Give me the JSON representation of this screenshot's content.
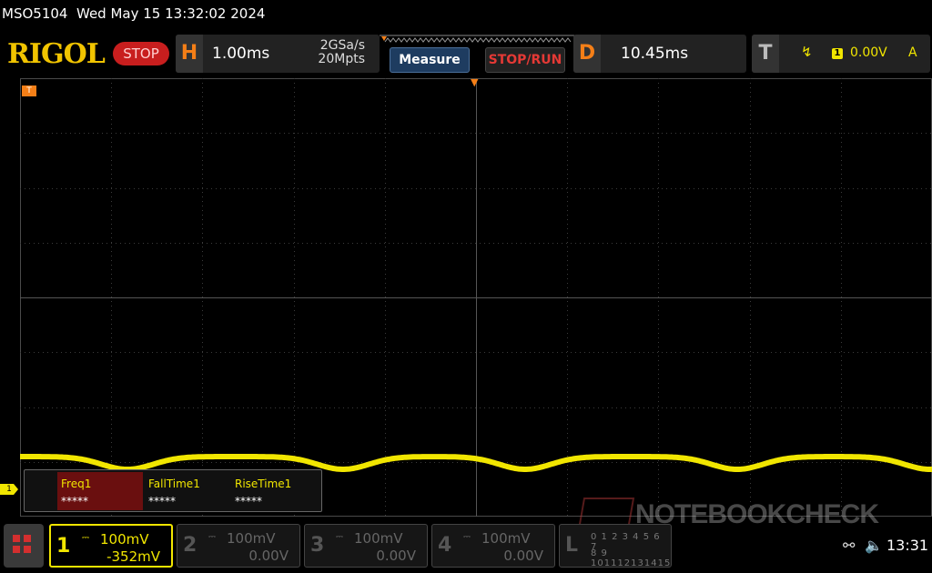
{
  "header": {
    "model": "MSO5104",
    "datetime": "Wed May 15 13:32:02 2024"
  },
  "toolbar": {
    "brand": "RIGOL",
    "run_state": "STOP",
    "horizontal": {
      "letter": "H",
      "timebase": "1.00ms",
      "sample_rate": "2GSa/s",
      "memory_depth": "20Mpts"
    },
    "measure_label": "Measure",
    "stop_run_label": "STOP/RUN",
    "delay": {
      "letter": "D",
      "value": "10.45ms"
    },
    "trigger": {
      "letter": "T",
      "source_channel": "1",
      "level": "0.00V",
      "mode": "A"
    }
  },
  "display": {
    "channel_marker": "1",
    "trigger_marker": "T",
    "waveform_color": "#f1e600"
  },
  "measurements": [
    {
      "label": "Freq1",
      "value": "*****",
      "highlighted": true
    },
    {
      "label": "FallTime1",
      "value": "*****",
      "highlighted": false
    },
    {
      "label": "RiseTime1",
      "value": "*****",
      "highlighted": false
    }
  ],
  "channels": [
    {
      "number": "1",
      "scale": "100mV",
      "offset": "-352mV",
      "active": true
    },
    {
      "number": "2",
      "scale": "100mV",
      "offset": "0.00V",
      "active": false
    },
    {
      "number": "3",
      "scale": "100mV",
      "offset": "0.00V",
      "active": false
    },
    {
      "number": "4",
      "scale": "100mV",
      "offset": "0.00V",
      "active": false
    }
  ],
  "logic": {
    "letter": "L",
    "row1": "0 1 2 3 4 5 6 7",
    "row2": "8 9 101112131415"
  },
  "watermark": "NOTEBOOKCHECK",
  "status": {
    "clock": "13:31"
  }
}
